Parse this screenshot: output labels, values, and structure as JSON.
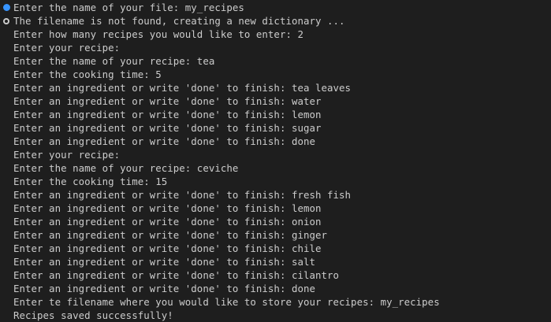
{
  "terminal": {
    "lines": [
      {
        "marker": "filled",
        "text": "Enter the name of your file: my_recipes"
      },
      {
        "marker": "hollow",
        "text": "The filename is not found, creating a new dictionary ..."
      },
      {
        "marker": "",
        "text": "Enter how many recipes you would like to enter: 2"
      },
      {
        "marker": "",
        "text": "Enter your recipe:"
      },
      {
        "marker": "",
        "text": "Enter the name of your recipe: tea"
      },
      {
        "marker": "",
        "text": "Enter the cooking time: 5"
      },
      {
        "marker": "",
        "text": "Enter an ingredient or write 'done' to finish: tea leaves"
      },
      {
        "marker": "",
        "text": "Enter an ingredient or write 'done' to finish: water"
      },
      {
        "marker": "",
        "text": "Enter an ingredient or write 'done' to finish: lemon"
      },
      {
        "marker": "",
        "text": "Enter an ingredient or write 'done' to finish: sugar"
      },
      {
        "marker": "",
        "text": "Enter an ingredient or write 'done' to finish: done"
      },
      {
        "marker": "",
        "text": "Enter your recipe:"
      },
      {
        "marker": "",
        "text": "Enter the name of your recipe: ceviche"
      },
      {
        "marker": "",
        "text": "Enter the cooking time: 15"
      },
      {
        "marker": "",
        "text": "Enter an ingredient or write 'done' to finish: fresh fish"
      },
      {
        "marker": "",
        "text": "Enter an ingredient or write 'done' to finish: lemon"
      },
      {
        "marker": "",
        "text": "Enter an ingredient or write 'done' to finish: onion"
      },
      {
        "marker": "",
        "text": "Enter an ingredient or write 'done' to finish: ginger"
      },
      {
        "marker": "",
        "text": "Enter an ingredient or write 'done' to finish: chile"
      },
      {
        "marker": "",
        "text": "Enter an ingredient or write 'done' to finish: salt"
      },
      {
        "marker": "",
        "text": "Enter an ingredient or write 'done' to finish: cilantro"
      },
      {
        "marker": "",
        "text": "Enter an ingredient or write 'done' to finish: done"
      },
      {
        "marker": "",
        "text": "Enter te filename where you would like to store your recipes: my_recipes"
      },
      {
        "marker": "",
        "text": "Recipes saved successfully!"
      }
    ]
  },
  "colors": {
    "background": "#1e1e1e",
    "text": "#cccccc",
    "marker_filled": "#3794ff",
    "marker_hollow": "#cccccc"
  }
}
